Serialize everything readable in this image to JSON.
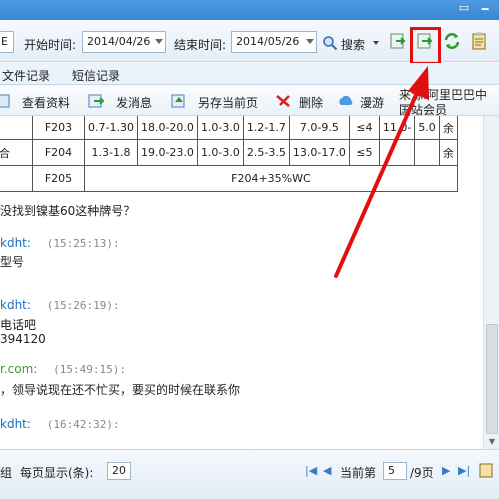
{
  "filter": {
    "start_prefix": "E",
    "start_label": "开始时间:",
    "start_value": "2014/04/26",
    "end_label": "结束时间:",
    "end_value": "2014/05/26",
    "search_label": "搜索"
  },
  "tabs": [
    "文件记录",
    "短信记录"
  ],
  "actions": {
    "view_profile": "查看资料",
    "send_message": "发消息",
    "save_page": "另存当前页",
    "delete": "删除",
    "roam": "漫游"
  },
  "source_text": "来源:阿里巴巴中国站会员",
  "table": {
    "rows": [
      [
        "",
        "F203",
        "0.7-1.30",
        "18.0-20.0",
        "1.0-3.0",
        "1.2-1.7",
        "7.0-9.5",
        "≤4",
        "11.0-",
        "5.0",
        "余"
      ],
      [
        "合",
        "F204",
        "1.3-1.8",
        "19.0-23.0",
        "1.0-3.0",
        "2.5-3.5",
        "13.0-17.0",
        "≤5",
        "",
        "",
        "余"
      ]
    ],
    "last_row": {
      "first": "",
      "code": "F205",
      "span": "F204+35%WC"
    }
  },
  "messages": [
    {
      "question": "没找到镍基60这种牌号？"
    },
    {
      "sender": "kdht:",
      "time": "(15:25:13):",
      "body": "型号"
    },
    {
      "sender": "kdht:",
      "time": "(15:26:19):",
      "body": "电话吧",
      "body2": "394120"
    },
    {
      "sender": "r.com:",
      "time": "(15:49:15):",
      "body": "，领导说现在还不忙买，要买的时候在联系你"
    },
    {
      "sender": "kdht:",
      "time": "(16:42:32):",
      "body": ""
    }
  ],
  "pager": {
    "group_label": "组",
    "per_page_label": "每页显示(条):",
    "per_page_value": "20",
    "current_label": "当前第",
    "current_value": "5",
    "total_label": "/9页"
  },
  "colors": {
    "annotation": "#e01010",
    "titlebar": "#3a86d4",
    "sender": "#1a6fc4"
  }
}
